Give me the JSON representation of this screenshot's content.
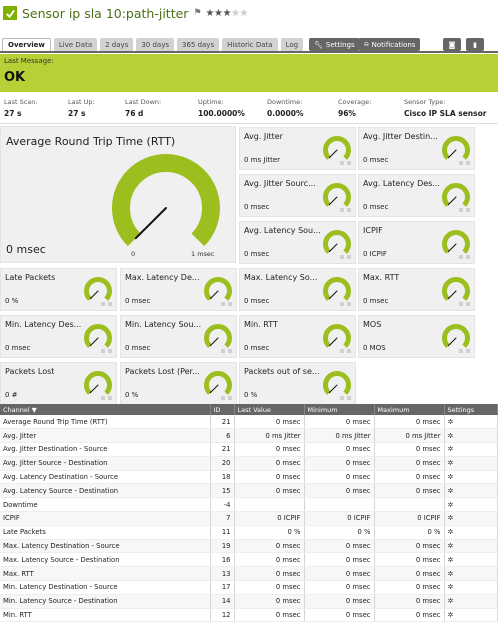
{
  "header": {
    "title": "Sensor ip sla 10:path-jitter",
    "stars_on": 3,
    "stars_total": 5
  },
  "tabs": [
    {
      "label": "Overview",
      "active": true
    },
    {
      "label": "Live Data",
      "active": false
    },
    {
      "label": "2 days",
      "active": false
    },
    {
      "label": "30 days",
      "active": false
    },
    {
      "label": "365 days",
      "active": false
    },
    {
      "label": "Historic Data",
      "active": false
    },
    {
      "label": "Log",
      "active": false
    }
  ],
  "toolbar": {
    "settings_label": "Settings",
    "notifications_label": "Notifications"
  },
  "message": {
    "label": "Last Message:",
    "value": "OK"
  },
  "stats": [
    {
      "label": "Last Scan:",
      "value": "27 s"
    },
    {
      "label": "Last Up:",
      "value": "27 s"
    },
    {
      "label": "Last Down:",
      "value": "76 d"
    },
    {
      "label": "Uptime:",
      "value": "100.0000%"
    },
    {
      "label": "Downtime:",
      "value": "0.0000%"
    },
    {
      "label": "Coverage:",
      "value": "96%"
    },
    {
      "label": "Sensor Type:",
      "value": "Cisco IP SLA sensor"
    }
  ],
  "big_gauge": {
    "name": "Average Round Trip Time (RTT)",
    "value": "0 msec",
    "min_label": "0",
    "max_label": "1 msec",
    "level": 0.0
  },
  "tiles": [
    {
      "name": "Avg. Jitter",
      "value": "0 ms Jitter"
    },
    {
      "name": "Avg. Jitter Destin...",
      "value": "0 msec"
    },
    {
      "name": "Avg. Jitter Sourc...",
      "value": "0 msec"
    },
    {
      "name": "Avg. Latency Des...",
      "value": "0 msec"
    },
    {
      "name": "Avg. Latency Sou...",
      "value": "0 msec"
    },
    {
      "name": "ICPIF",
      "value": "0 ICPIF"
    },
    {
      "name": "Late Packets",
      "value": "0 %"
    },
    {
      "name": "Max. Latency De...",
      "value": "0 msec"
    },
    {
      "name": "Max. Latency So...",
      "value": "0 msec"
    },
    {
      "name": "Max. RTT",
      "value": "0 msec"
    },
    {
      "name": "Min. Latency Des...",
      "value": "0 msec"
    },
    {
      "name": "Min. Latency Sou...",
      "value": "0 msec"
    },
    {
      "name": "Min. RTT",
      "value": "0 msec"
    },
    {
      "name": "MOS",
      "value": "0 MOS"
    },
    {
      "name": "Packets Lost",
      "value": "0 #"
    },
    {
      "name": "Packets Lost (Per...",
      "value": "0 %"
    },
    {
      "name": "Packets out of se...",
      "value": "0 %"
    }
  ],
  "table": {
    "headers": [
      "Channel",
      "ID",
      "Last Value",
      "Minimum",
      "Maximum",
      "Settings"
    ],
    "rows": [
      [
        "Average Round Trip Time (RTT)",
        "21",
        "0 msec",
        "0 msec",
        "0 msec"
      ],
      [
        "Avg. Jitter",
        "6",
        "0 ms Jitter",
        "0 ms Jitter",
        "0 ms Jitter"
      ],
      [
        "Avg. Jitter Destination - Source",
        "21",
        "0 msec",
        "0 msec",
        "0 msec"
      ],
      [
        "Avg. Jitter Source - Destination",
        "20",
        "0 msec",
        "0 msec",
        "0 msec"
      ],
      [
        "Avg. Latency Destination - Source",
        "18",
        "0 msec",
        "0 msec",
        "0 msec"
      ],
      [
        "Avg. Latency Source - Destination",
        "15",
        "0 msec",
        "0 msec",
        "0 msec"
      ],
      [
        "Downtime",
        "-4",
        "",
        "",
        ""
      ],
      [
        "ICPIF",
        "7",
        "0 ICPIF",
        "0 ICPIF",
        "0 ICPIF"
      ],
      [
        "Late Packets",
        "11",
        "0 %",
        "0 %",
        "0 %"
      ],
      [
        "Max. Latency Destination - Source",
        "19",
        "0 msec",
        "0 msec",
        "0 msec"
      ],
      [
        "Max. Latency Source - Destination",
        "16",
        "0 msec",
        "0 msec",
        "0 msec"
      ],
      [
        "Max. RTT",
        "13",
        "0 msec",
        "0 msec",
        "0 msec"
      ],
      [
        "Min. Latency Destination - Source",
        "17",
        "0 msec",
        "0 msec",
        "0 msec"
      ],
      [
        "Min. Latency Source - Destination",
        "14",
        "0 msec",
        "0 msec",
        "0 msec"
      ],
      [
        "Min. RTT",
        "12",
        "0 msec",
        "0 msec",
        "0 msec"
      ]
    ]
  },
  "colors": {
    "accent": "#b5d135",
    "gauge": "#9dbe1f",
    "title": "#4a6f14"
  }
}
